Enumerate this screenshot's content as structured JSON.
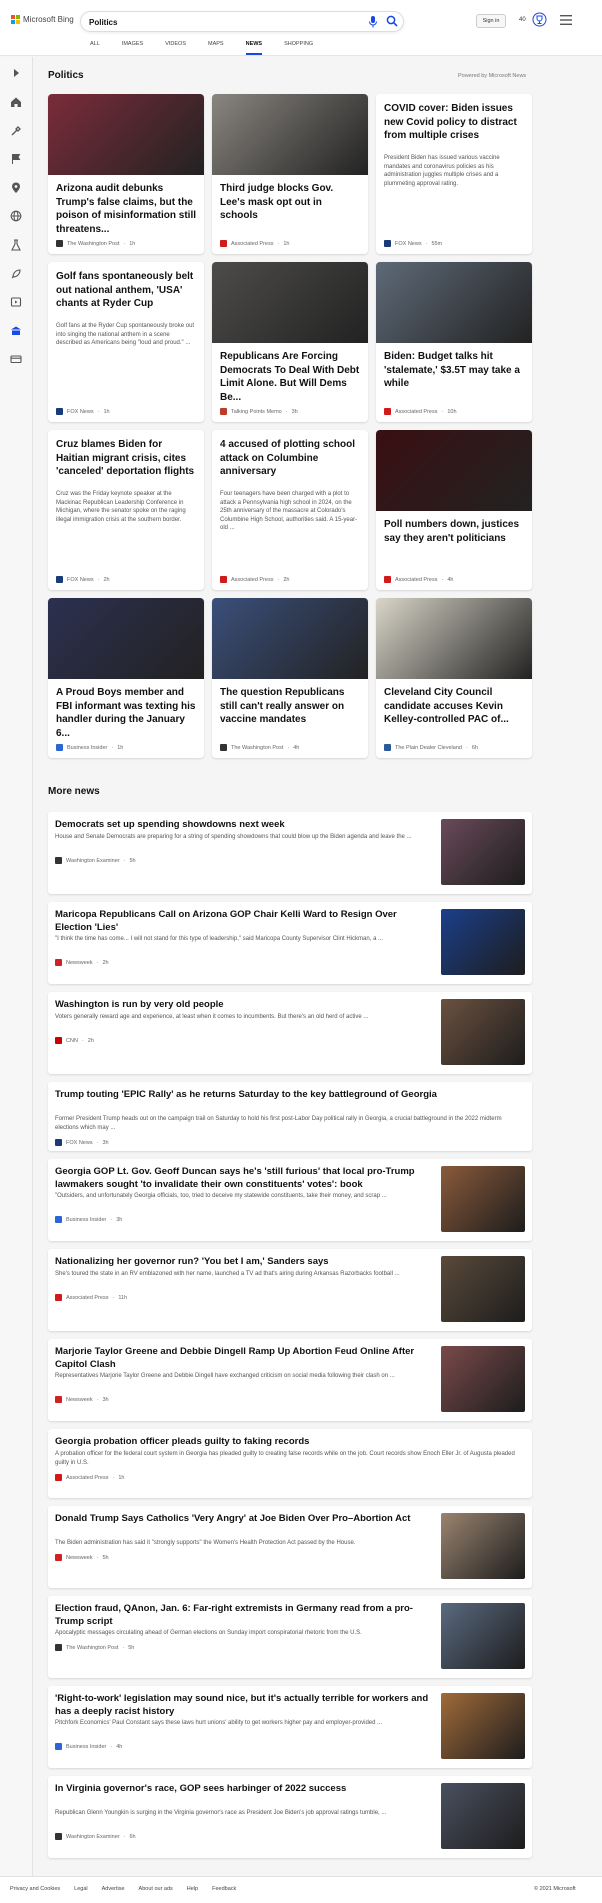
{
  "header": {
    "brand": "Microsoft Bing",
    "query": "Politics",
    "signin": "Sign in",
    "points": "40"
  },
  "tabs": [
    {
      "label": "ALL"
    },
    {
      "label": "IMAGES"
    },
    {
      "label": "VIDEOS"
    },
    {
      "label": "MAPS"
    },
    {
      "label": "NEWS"
    },
    {
      "label": "SHOPPING"
    }
  ],
  "section": {
    "title": "Politics",
    "powered": "Powered by Microsoft News"
  },
  "cards": [
    {
      "title": "Arizona audit debunks Trump's false claims, but the poison of misinformation still threatens...",
      "snippet": "",
      "source": "The Washington Post",
      "time": "1h",
      "srcColor": "#333",
      "img": "#7b2c3a"
    },
    {
      "title": "Third judge blocks Gov. Lee's mask opt out in schools",
      "snippet": "",
      "source": "Associated Press",
      "time": "1h",
      "srcColor": "#d21a1a",
      "img": "#8a8680"
    },
    {
      "title": "COVID cover: Biden issues new Covid policy to distract from multiple crises",
      "snippet": "President Biden has issued various vaccine mandates and coronavirus policies as his administration juggles multiple crises and a plummeting approval rating.",
      "source": "FOX News",
      "time": "55m",
      "srcColor": "#1b3a7a",
      "img": ""
    },
    {
      "title": "Golf fans spontaneously belt out national anthem, 'USA' chants at Ryder Cup",
      "snippet": "Golf fans at the Ryder Cup spontaneously broke out into singing the national anthem in a scene described as Americans being \"loud and proud.\" ...",
      "source": "FOX News",
      "time": "1h",
      "srcColor": "#1b3a7a",
      "img": ""
    },
    {
      "title": "Republicans Are Forcing Democrats To Deal With Debt Limit Alone. But Will Dems Be...",
      "snippet": "",
      "source": "Talking Points Memo",
      "time": "3h",
      "srcColor": "#c0392b",
      "img": "#4d4c4a"
    },
    {
      "title": "Biden: Budget talks hit 'stalemate,' $3.5T may take a while",
      "snippet": "",
      "source": "Associated Press",
      "time": "10h",
      "srcColor": "#d21a1a",
      "img": "#5e6a78"
    },
    {
      "title": "Cruz blames Biden for Haitian migrant crisis, cites 'canceled' deportation flights",
      "snippet": "Cruz was the Friday keynote speaker at the Mackinac Republican Leadership Conference in Michigan, where the senator spoke on the raging illegal immigration crisis at the southern border.",
      "source": "FOX News",
      "time": "2h",
      "srcColor": "#1b3a7a",
      "img": ""
    },
    {
      "title": "4 accused of plotting school attack on Columbine anniversary",
      "snippet": "Four teenagers have been charged with a plot to attack a Pennsylvania high school in 2024, on the 25th anniversary of the massacre at Colorado's Columbine High School, authorities said. A 15-year-old ...",
      "source": "Associated Press",
      "time": "2h",
      "srcColor": "#d21a1a",
      "img": ""
    },
    {
      "title": "Poll numbers down, justices say they aren't politicians",
      "snippet": "",
      "source": "Associated Press",
      "time": "4h",
      "srcColor": "#d21a1a",
      "img": "#3a0f12"
    },
    {
      "title": "A Proud Boys member and FBI informant was texting his handler during the January 6...",
      "snippet": "",
      "source": "Business Insider",
      "time": "1h",
      "srcColor": "#2b66d9",
      "img": "#2c3050"
    },
    {
      "title": "The question Republicans still can't really answer on vaccine mandates",
      "snippet": "",
      "source": "The Washington Post",
      "time": "4h",
      "srcColor": "#333",
      "img": "#3a4f7a"
    },
    {
      "title": "Cleveland City Council candidate accuses Kevin Kelley-controlled PAC of...",
      "snippet": "",
      "source": "The Plain Dealer Cleveland",
      "time": "6h",
      "srcColor": "#2a5b9a",
      "img": "#d9d5c8"
    }
  ],
  "more": {
    "title": "More news",
    "items": [
      {
        "title": "Democrats set up spending showdowns next week",
        "snippet": "House and Senate Democrats are preparing for a string of spending showdowns that could blow up the Biden agenda and leave the ...",
        "source": "Washington Examiner",
        "time": "5h",
        "srcColor": "#333",
        "img": "#6a4a5a"
      },
      {
        "title": "Maricopa Republicans Call on Arizona GOP Chair Kelli Ward to Resign Over Election 'Lies'",
        "snippet": "\"I think the time has come... I will not stand for this type of leadership,\" said Maricopa County Supervisor Clint Hickman, a ...",
        "source": "Newsweek",
        "time": "2h",
        "srcColor": "#d31f26",
        "img": "#1b3f8a"
      },
      {
        "title": "Washington is run by very old people",
        "snippet": "Voters generally reward age and experience, at least when it comes to incumbents. But there's an old herd of active ...",
        "source": "CNN",
        "time": "2h",
        "srcColor": "#cc0000",
        "img": "#6b5140"
      },
      {
        "title": "Trump touting 'EPIC Rally' as he returns Saturday to the key battleground of Georgia",
        "snippet": "Former President Trump heads out on the campaign trail on Saturday to hold his first post-Labor Day political rally in Georgia, a crucial battleground in the 2022 midterm elections which may ...",
        "source": "FOX News",
        "time": "3h",
        "srcColor": "#1b3a7a",
        "img": ""
      },
      {
        "title": "Georgia GOP Lt. Gov. Geoff Duncan says he's 'still furious' that local pro-Trump lawmakers sought 'to invalidate their own constituents' votes': book",
        "snippet": "\"Outsiders, and unfortunately Georgia officials, too, tried to deceive my statewide constituents, take their money, and scrap ...",
        "source": "Business Insider",
        "time": "3h",
        "srcColor": "#2b66d9",
        "img": "#8a5a3a"
      },
      {
        "title": "Nationalizing her governor run? 'You bet I am,' Sanders says",
        "snippet": "She's toured the state in an RV emblazoned with her name, launched a TV ad that's airing during Arkansas Razorbacks football ...",
        "source": "Associated Press",
        "time": "11h",
        "srcColor": "#d21a1a",
        "img": "#5a4a3a"
      },
      {
        "title": "Marjorie Taylor Greene and Debbie Dingell Ramp Up Abortion Feud Online After Capitol Clash",
        "snippet": "Representatives Marjorie Taylor Greene and Debbie Dingell have exchanged criticism on social media following their clash on ...",
        "source": "Newsweek",
        "time": "3h",
        "srcColor": "#d31f26",
        "img": "#7a4a4a"
      },
      {
        "title": "Georgia probation officer pleads guilty to faking records",
        "snippet": "A probation officer for the federal court system in Georgia has pleaded guilty to creating false records while on the job. Court records show Enoch Eller Jr. of Augusta pleaded guilty in U.S.",
        "source": "Associated Press",
        "time": "1h",
        "srcColor": "#d21a1a",
        "img": ""
      },
      {
        "title": "Donald Trump Says Catholics 'Very Angry' at Joe Biden Over Pro–Abortion Act",
        "snippet": "The Biden administration has said it \"strongly supports\" the Women's Health Protection Act passed by the House.",
        "source": "Newsweek",
        "time": "5h",
        "srcColor": "#d31f26",
        "img": "#9a8470"
      },
      {
        "title": "Election fraud, QAnon, Jan. 6: Far-right extremists in Germany read from a pro-Trump script",
        "snippet": "Apocalyptic messages circulating ahead of German elections on Sunday import conspiratorial rhetoric from the U.S.",
        "source": "The Washington Post",
        "time": "5h",
        "srcColor": "#333",
        "img": "#5a6a80"
      },
      {
        "title": "'Right-to-work' legislation may sound nice, but it's actually terrible for workers and has a deeply racist history",
        "snippet": "Pitchfork Economics' Paul Constant says these laws hurt unions' ability to get workers higher pay and employer-provided ...",
        "source": "Business Insider",
        "time": "4h",
        "srcColor": "#2b66d9",
        "img": "#a06a3a"
      },
      {
        "title": "In Virginia governor's race, GOP sees harbinger of 2022 success",
        "snippet": "Republican Glenn Youngkin is surging in the Virginia governor's race as President Joe Biden's job approval ratings tumble, ...",
        "source": "Washington Examiner",
        "time": "6h",
        "srcColor": "#333",
        "img": "#4a5060"
      }
    ]
  },
  "footer": {
    "links": [
      "Privacy and Cookies",
      "Legal",
      "Advertise",
      "About our ads",
      "Help",
      "Feedback"
    ],
    "copyright": "© 2021 Microsoft"
  }
}
